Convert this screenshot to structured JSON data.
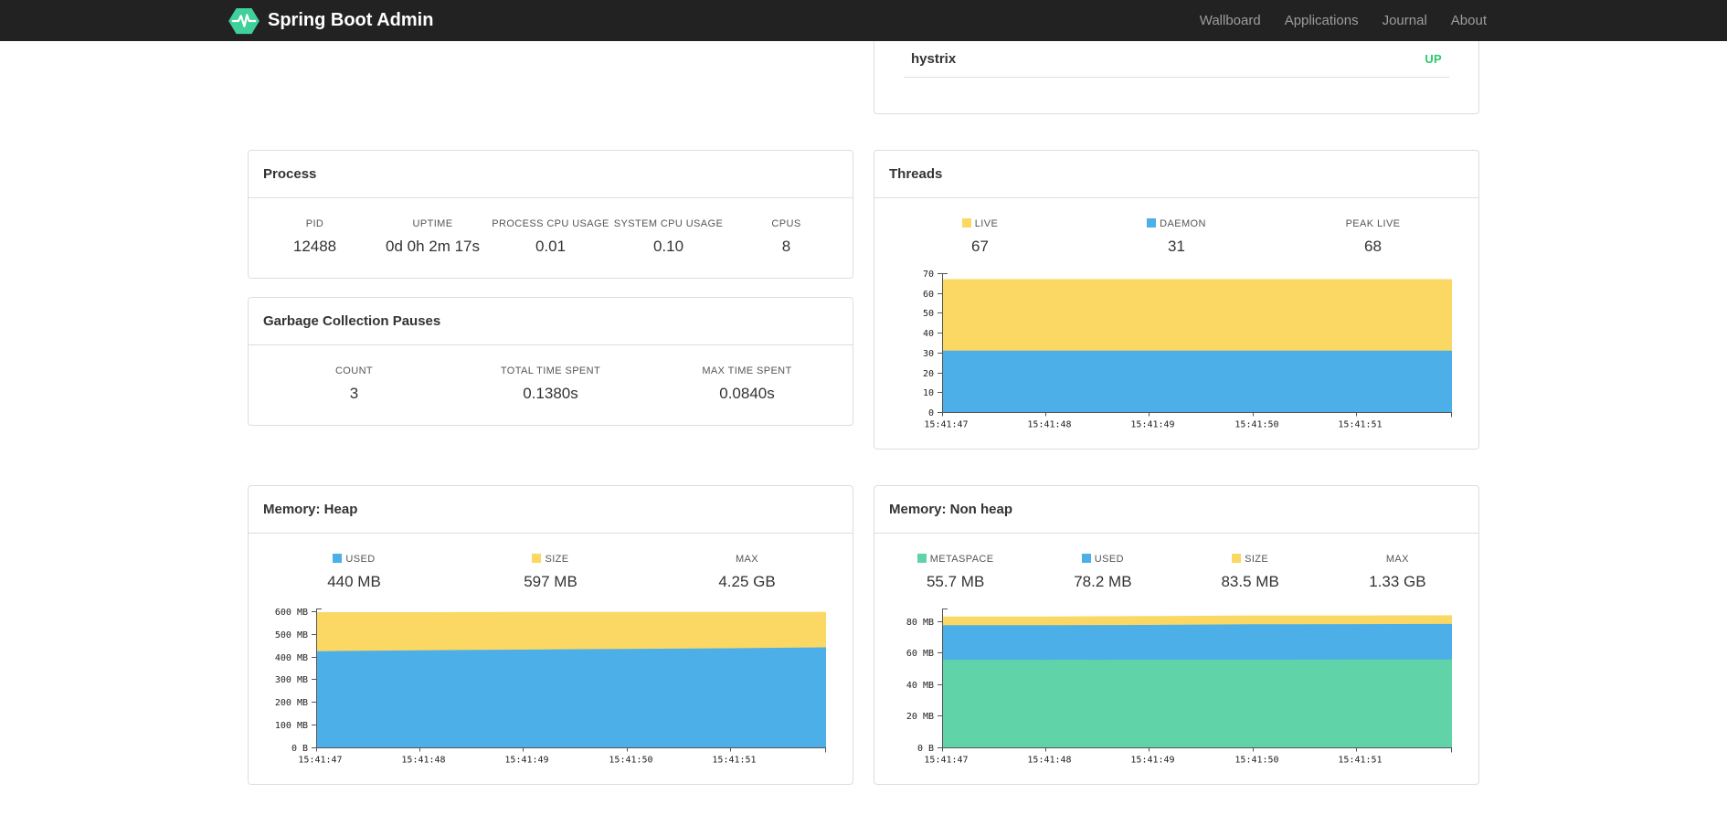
{
  "navbar": {
    "brand": "Spring Boot Admin",
    "logo_color": "#3fd09c",
    "links": [
      {
        "label": "Wallboard"
      },
      {
        "label": "Applications"
      },
      {
        "label": "Journal"
      },
      {
        "label": "About"
      }
    ]
  },
  "application": {
    "name": "hystrix",
    "status": "UP",
    "status_color": "#2bca6b"
  },
  "panels": {
    "process": {
      "title": "Process",
      "metrics": [
        {
          "label": "PID",
          "value": "12488"
        },
        {
          "label": "UPTIME",
          "value": "0d 0h 2m 17s"
        },
        {
          "label": "PROCESS CPU USAGE",
          "value": "0.01"
        },
        {
          "label": "SYSTEM CPU USAGE",
          "value": "0.10"
        },
        {
          "label": "CPUS",
          "value": "8"
        }
      ]
    },
    "gc": {
      "title": "Garbage Collection Pauses",
      "metrics": [
        {
          "label": "COUNT",
          "value": "3"
        },
        {
          "label": "TOTAL TIME SPENT",
          "value": "0.1380s"
        },
        {
          "label": "MAX TIME SPENT",
          "value": "0.0840s"
        }
      ]
    },
    "threads": {
      "title": "Threads",
      "metrics": [
        {
          "label": "LIVE",
          "value": "67",
          "swatch": "#fbd863"
        },
        {
          "label": "DAEMON",
          "value": "31",
          "swatch": "#4cafe8"
        },
        {
          "label": "PEAK LIVE",
          "value": "68"
        }
      ]
    },
    "heap": {
      "title": "Memory: Heap",
      "metrics": [
        {
          "label": "USED",
          "value": "440 MB",
          "swatch": "#4cafe8"
        },
        {
          "label": "SIZE",
          "value": "597 MB",
          "swatch": "#fbd863"
        },
        {
          "label": "MAX",
          "value": "4.25 GB"
        }
      ]
    },
    "nonheap": {
      "title": "Memory: Non heap",
      "metrics": [
        {
          "label": "METASPACE",
          "value": "55.7 MB",
          "swatch": "#60d3a8"
        },
        {
          "label": "USED",
          "value": "78.2 MB",
          "swatch": "#4cafe8"
        },
        {
          "label": "SIZE",
          "value": "83.5 MB",
          "swatch": "#fbd863"
        },
        {
          "label": "MAX",
          "value": "1.33 GB"
        }
      ]
    }
  },
  "chart_data": [
    {
      "id": "threads",
      "type": "area",
      "stacked": true,
      "title": "Threads",
      "x_tick_labels": [
        "15:41:47",
        "15:41:48",
        "15:41:49",
        "15:41:50",
        "15:41:51"
      ],
      "x": [
        0,
        1,
        2,
        3,
        4,
        4.93
      ],
      "xlim": [
        0,
        4.93
      ],
      "ylim": [
        0,
        70
      ],
      "grid": false,
      "legend_position": "top",
      "y_ticks": [
        {
          "v": 0,
          "label": "0"
        },
        {
          "v": 10,
          "label": "10"
        },
        {
          "v": 20,
          "label": "20"
        },
        {
          "v": 30,
          "label": "30"
        },
        {
          "v": 40,
          "label": "40"
        },
        {
          "v": 50,
          "label": "50"
        },
        {
          "v": 60,
          "label": "60"
        },
        {
          "v": 70,
          "label": "70"
        }
      ],
      "series": [
        {
          "name": "DAEMON",
          "color": "#4cafe8",
          "values": [
            31,
            31,
            31,
            31,
            31,
            31
          ]
        },
        {
          "name": "LIVE",
          "color": "#fbd863",
          "values": [
            67,
            67,
            67,
            67,
            67,
            67
          ]
        }
      ]
    },
    {
      "id": "memory-heap",
      "type": "area",
      "stacked": true,
      "title": "Memory: Heap",
      "x_tick_labels": [
        "15:41:47",
        "15:41:48",
        "15:41:49",
        "15:41:50",
        "15:41:51"
      ],
      "x": [
        0,
        1,
        2,
        3,
        4,
        4.93
      ],
      "xlim": [
        0,
        4.93
      ],
      "ylim": [
        0,
        612
      ],
      "grid": false,
      "legend_position": "top",
      "y_ticks": [
        {
          "v": 0,
          "label": "0 B"
        },
        {
          "v": 100,
          "label": "100 MB"
        },
        {
          "v": 200,
          "label": "200 MB"
        },
        {
          "v": 300,
          "label": "300 MB"
        },
        {
          "v": 400,
          "label": "400 MB"
        },
        {
          "v": 500,
          "label": "500 MB"
        },
        {
          "v": 600,
          "label": "600 MB"
        }
      ],
      "series": [
        {
          "name": "USED",
          "color": "#4cafe8",
          "values": [
            424,
            428,
            431,
            434,
            437,
            441
          ]
        },
        {
          "name": "SIZE",
          "color": "#fbd863",
          "values": [
            596,
            596,
            596.5,
            597,
            597,
            597
          ]
        }
      ]
    },
    {
      "id": "memory-nonheap",
      "type": "area",
      "stacked": true,
      "title": "Memory: Non heap",
      "x_tick_labels": [
        "15:41:47",
        "15:41:48",
        "15:41:49",
        "15:41:50",
        "15:41:51"
      ],
      "x": [
        0,
        1,
        2,
        3,
        4,
        4.93
      ],
      "xlim": [
        0,
        4.93
      ],
      "ylim": [
        0,
        88
      ],
      "grid": false,
      "legend_position": "top",
      "y_ticks": [
        {
          "v": 0,
          "label": "0 B"
        },
        {
          "v": 20,
          "label": "20 MB"
        },
        {
          "v": 40,
          "label": "40 MB"
        },
        {
          "v": 60,
          "label": "60 MB"
        },
        {
          "v": 80,
          "label": "80 MB"
        }
      ],
      "series": [
        {
          "name": "METASPACE",
          "color": "#60d3a8",
          "values": [
            55.5,
            55.5,
            55.6,
            55.6,
            55.7,
            55.7
          ]
        },
        {
          "name": "USED",
          "color": "#4cafe8",
          "values": [
            77.4,
            77.4,
            77.6,
            78.0,
            78.1,
            78.2
          ]
        },
        {
          "name": "SIZE",
          "color": "#fbd863",
          "values": [
            82.9,
            82.9,
            83.2,
            83.6,
            83.6,
            83.7
          ]
        }
      ]
    }
  ]
}
